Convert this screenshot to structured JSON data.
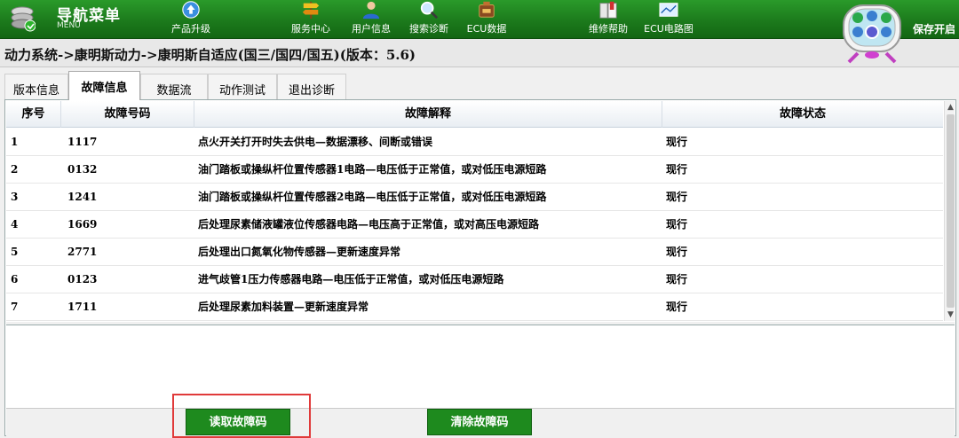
{
  "nav": {
    "menu_title": "导航菜单",
    "menu_sub": "MENU",
    "items": [
      {
        "label": "产品升级",
        "icon": "upgrade-globe-icon"
      },
      {
        "label": "服务中心",
        "icon": "service-signpost-icon"
      },
      {
        "label": "用户信息",
        "icon": "user-icon"
      },
      {
        "label": "搜索诊断",
        "icon": "search-icon"
      },
      {
        "label": "ECU数据",
        "icon": "ecu-chip-icon"
      },
      {
        "label": "维修帮助",
        "icon": "repair-book-icon"
      },
      {
        "label": "ECU电路图",
        "icon": "circuit-diagram-icon"
      }
    ],
    "store_label": "保存开启"
  },
  "breadcrumb": "动力系统->康明斯动力->康明斯自适应(国三/国四/国五)(版本：5.6)",
  "tabs": [
    {
      "label": "版本信息",
      "active": false
    },
    {
      "label": "故障信息",
      "active": true
    },
    {
      "label": "数据流",
      "active": false
    },
    {
      "label": "动作测试",
      "active": false
    },
    {
      "label": "退出诊断",
      "active": false
    }
  ],
  "table": {
    "headers": [
      "序号",
      "故障号码",
      "故障解释",
      "故障状态"
    ],
    "rows": [
      {
        "index": "1",
        "code": "1117",
        "desc": "点火开关打开时失去供电—数据漂移、间断或错误",
        "status": "现行"
      },
      {
        "index": "2",
        "code": "0132",
        "desc": "油门踏板或操纵杆位置传感器1电路—电压低于正常值，或对低压电源短路",
        "status": "现行"
      },
      {
        "index": "3",
        "code": "1241",
        "desc": "油门踏板或操纵杆位置传感器2电路—电压低于正常值，或对低压电源短路",
        "status": "现行"
      },
      {
        "index": "4",
        "code": "1669",
        "desc": "后处理尿素储液罐液位传感器电路—电压高于正常值，或对高压电源短路",
        "status": "现行"
      },
      {
        "index": "5",
        "code": "2771",
        "desc": "后处理出口氮氧化物传感器—更新速度异常",
        "status": "现行"
      },
      {
        "index": "6",
        "code": "0123",
        "desc": "进气歧管1压力传感器电路—电压低于正常值，或对低压电源短路",
        "status": "现行"
      },
      {
        "index": "7",
        "code": "1711",
        "desc": "后处理尿素加料装置—更新速度异常",
        "status": "现行"
      }
    ]
  },
  "buttons": {
    "read": "读取故障码",
    "clear": "清除故障码"
  },
  "colors": {
    "nav_green": "#1c7a1c",
    "button_green": "#1e8a1e",
    "highlight_red": "#e03a3a"
  }
}
